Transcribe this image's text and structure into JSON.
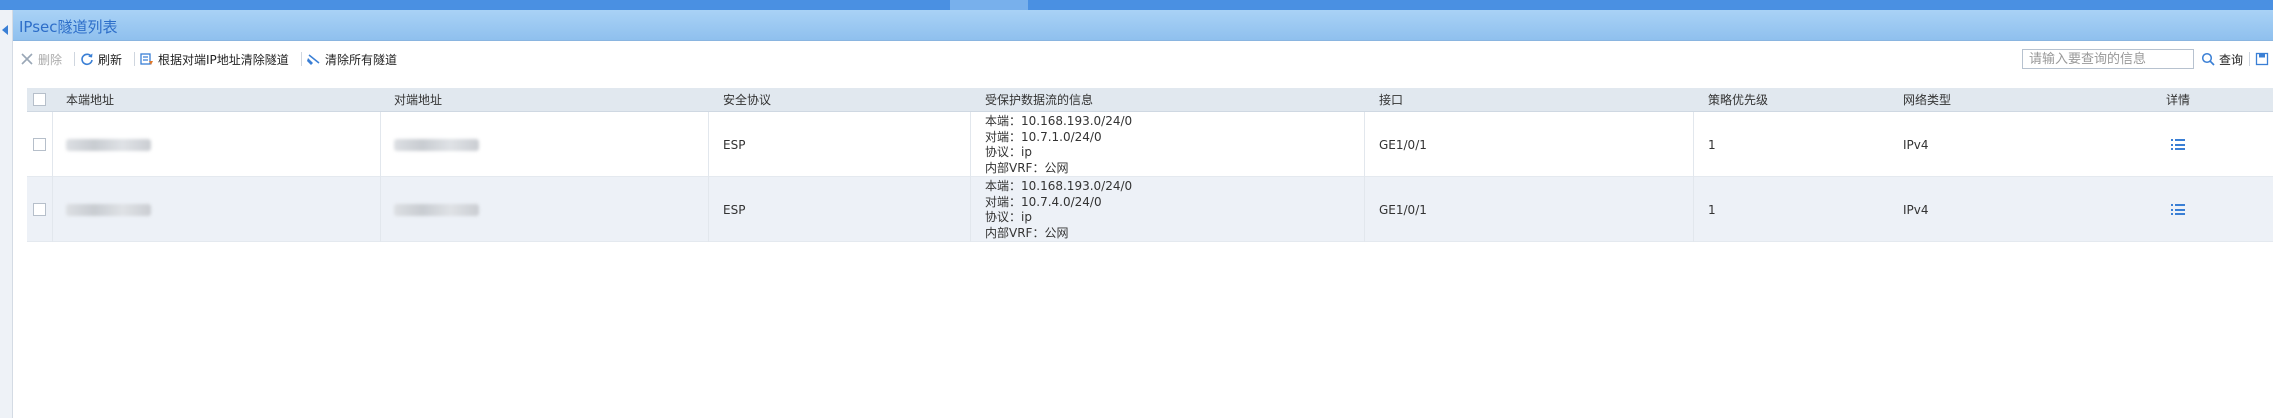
{
  "topnav": {
    "tabs": [
      "",
      "",
      "",
      "",
      "",
      ""
    ],
    "active_index": 4
  },
  "panel": {
    "title": "IPsec隧道列表"
  },
  "toolbar": {
    "delete_label": "删除",
    "refresh_label": "刷新",
    "clear_by_peer_label": "根据对端IP地址清除隧道",
    "clear_all_label": "清除所有隧道",
    "search_placeholder": "请输入要查询的信息",
    "query_label": "查询"
  },
  "table": {
    "columns": [
      "本端地址",
      "对端地址",
      "安全协议",
      "受保护数据流的信息",
      "接口",
      "策略优先级",
      "网络类型",
      "详情"
    ],
    "rows": [
      {
        "local": "",
        "peer": "",
        "protocol": "ESP",
        "info": [
          "本端：10.168.193.0/24/0",
          "对端：10.7.1.0/24/0",
          "协议：ip",
          "内部VRF：公网"
        ],
        "interface": "GE1/0/1",
        "priority": "1",
        "network_type": "IPv4"
      },
      {
        "local": "",
        "peer": "",
        "protocol": "ESP",
        "info": [
          "本端：10.168.193.0/24/0",
          "对端：10.7.4.0/24/0",
          "协议：ip",
          "内部VRF：公网"
        ],
        "interface": "GE1/0/1",
        "priority": "1",
        "network_type": "IPv4"
      }
    ]
  },
  "colors": {
    "accent": "#3a7fd5",
    "header_bg": "#8fc0ee",
    "row_alt": "#edf1f7"
  }
}
